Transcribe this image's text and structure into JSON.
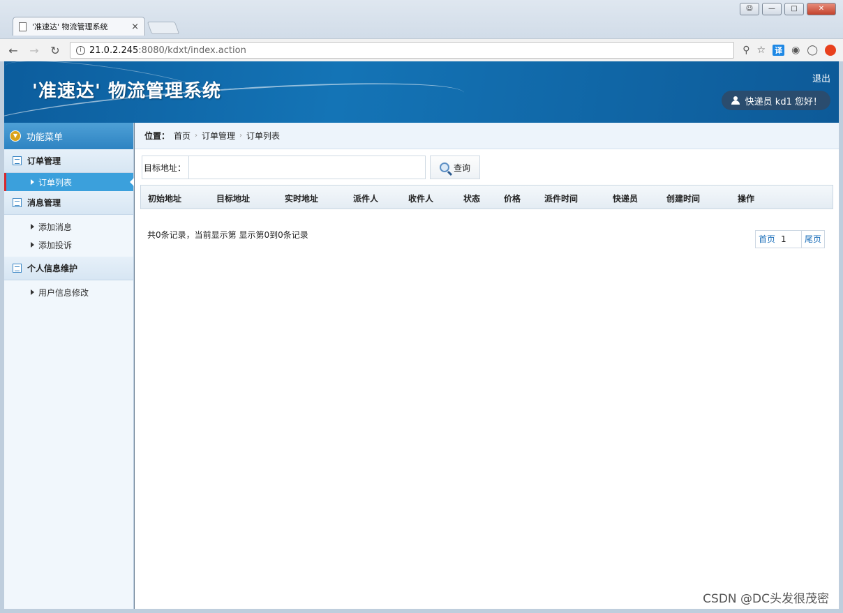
{
  "browser": {
    "tab_title": "'准速达' 物流管理系统",
    "tab_close": "×",
    "url_host": "21.0.2.245",
    "url_path": ":8080/kdxt/index.action",
    "translate_label": "译"
  },
  "header": {
    "title": "'准速达' 物流管理系统",
    "logout": "退出",
    "greeting": "快递员 kd1 您好！"
  },
  "sidebar": {
    "heading": "功能菜单",
    "groups": [
      {
        "label": "订单管理",
        "items": [
          {
            "label": "订单列表",
            "active": true
          }
        ]
      },
      {
        "label": "消息管理",
        "items": [
          {
            "label": "添加消息"
          },
          {
            "label": "添加投诉"
          }
        ]
      },
      {
        "label": "个人信息维护",
        "items": [
          {
            "label": "用户信息修改"
          }
        ]
      }
    ]
  },
  "breadcrumb": {
    "label": "位置：",
    "items": [
      "首页",
      "订单管理",
      "订单列表"
    ]
  },
  "search": {
    "label": "目标地址：",
    "value": "",
    "placeholder": "",
    "button": "查询"
  },
  "table": {
    "columns": [
      "初始地址",
      "目标地址",
      "实时地址",
      "派件人",
      "收件人",
      "状态",
      "价格",
      "派件时间",
      "快递员",
      "创建时间",
      "操作"
    ],
    "rows": []
  },
  "pager": {
    "info": "共0条记录，当前显示第  显示第0到0条记录",
    "first": "首页",
    "current": "1",
    "last": "尾页"
  },
  "watermark": "CSDN @DC头发很茂密",
  "colors": {
    "header_bg": "#0c5d9d",
    "sidebar_active": "#3ba0dc",
    "active_marker": "#d8282e",
    "link": "#1c6fba"
  }
}
